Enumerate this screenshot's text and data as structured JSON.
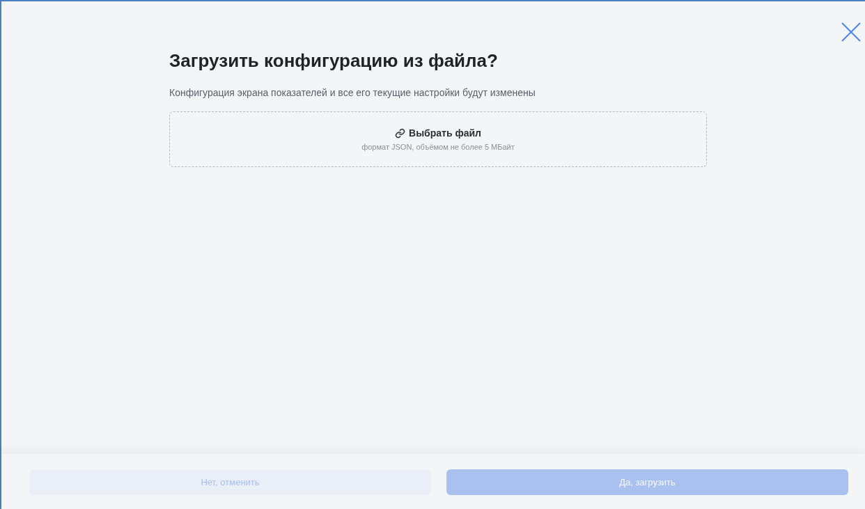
{
  "dialog": {
    "title": "Загрузить конфигурацию из файла?",
    "description": "Конфигурация экрана показателей и все его текущие настройки будут изменены",
    "upload": {
      "label": "Выбрать файл",
      "hint": "формат JSON, объёмом не более 5 МБайт"
    },
    "buttons": [
      {
        "kind": "secondary",
        "label": "Нет, отменить",
        "disabled": true
      },
      {
        "kind": "primary",
        "label": "Да, загрузить",
        "disabled": true
      }
    ]
  }
}
